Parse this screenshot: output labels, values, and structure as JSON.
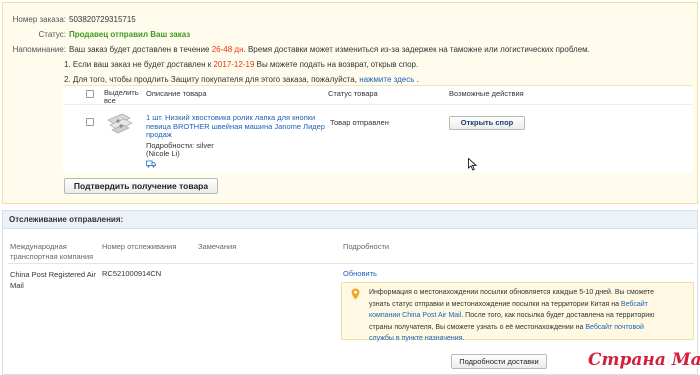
{
  "order": {
    "number_label": "Номер заказа:",
    "number_value": "503820729315715",
    "status_label": "Статус:",
    "status_value": "Продавец отправил Ваш заказ",
    "reminder_label": "Напоминание:",
    "reminder_pre": "Ваш заказ будет доставлен в течение",
    "reminder_hours": "26-48 дн",
    "reminder_post": ". Время доставки может измениться из-за задержек на таможне или логистических проблем.",
    "notice1_pre": "1. Если ваш заказ не будет доставлен к",
    "notice1_date": "2017-12-19",
    "notice1_post": "Вы можете подать на возврат, открыв спор.",
    "notice2_pre": "2. Для того, чтобы продлить Защиту покупателя для этого заказа, пожалуйста,",
    "notice2_link": "нажмите здесь",
    "notice2_post": "."
  },
  "products": {
    "select_all_label_1": "Выделить",
    "select_all_label_2": "все",
    "col_description": "Описание товара",
    "col_status": "Статус товара",
    "col_actions": "Возможные действия",
    "item": {
      "title_1": "1 шт. Низкий хвостовика ролик лапка для кнопки",
      "title_2": "певица BROTHER швейная машина Janome Лидер",
      "title_3": "продаж",
      "details": "Подробности: silver",
      "seller": "(Nicole Li)",
      "status": "Товар отправлен",
      "dispute_button": "Открыть спор"
    },
    "confirm_button": "Подтвердить получение товара"
  },
  "tracking": {
    "section_title": "Отслеживание отправления:",
    "col_company_1": "Международная",
    "col_company_2": "транспортная компания",
    "col_tracking": "Номер отслеживания",
    "col_remarks": "Замечания",
    "col_details": "Подробности",
    "company_1": "China Post Registered Air",
    "company_2": "Mail",
    "tracking_number": "RC521000914CN",
    "update_link": "Обновить",
    "info_1": "Информация о местонахождении посылки обновляется каждые 5-10 дней. Вы сможете",
    "info_2": "узнать статус отправки и местонахождение посылки на территории Китая на",
    "info_link_1": "Вебсайт",
    "info_link_2": "компании China Post Air Mail",
    "info_3": ". После того, как посылка будет доставлена на территорию",
    "info_4": "страны получателя, Вы сможете узнать о её местонахождении на",
    "info_link_3": "Вебсайт почтовой",
    "info_link_4": "службы в пункте назначения",
    "info_5": ".",
    "details_button": "Подробности доставки"
  },
  "watermark": "Страна Мам",
  "colors": {
    "status_green": "#3a9b1e",
    "highlight_red": "#e4380d",
    "link_blue": "#1c62b9",
    "watermark_red": "#d41f3b"
  }
}
